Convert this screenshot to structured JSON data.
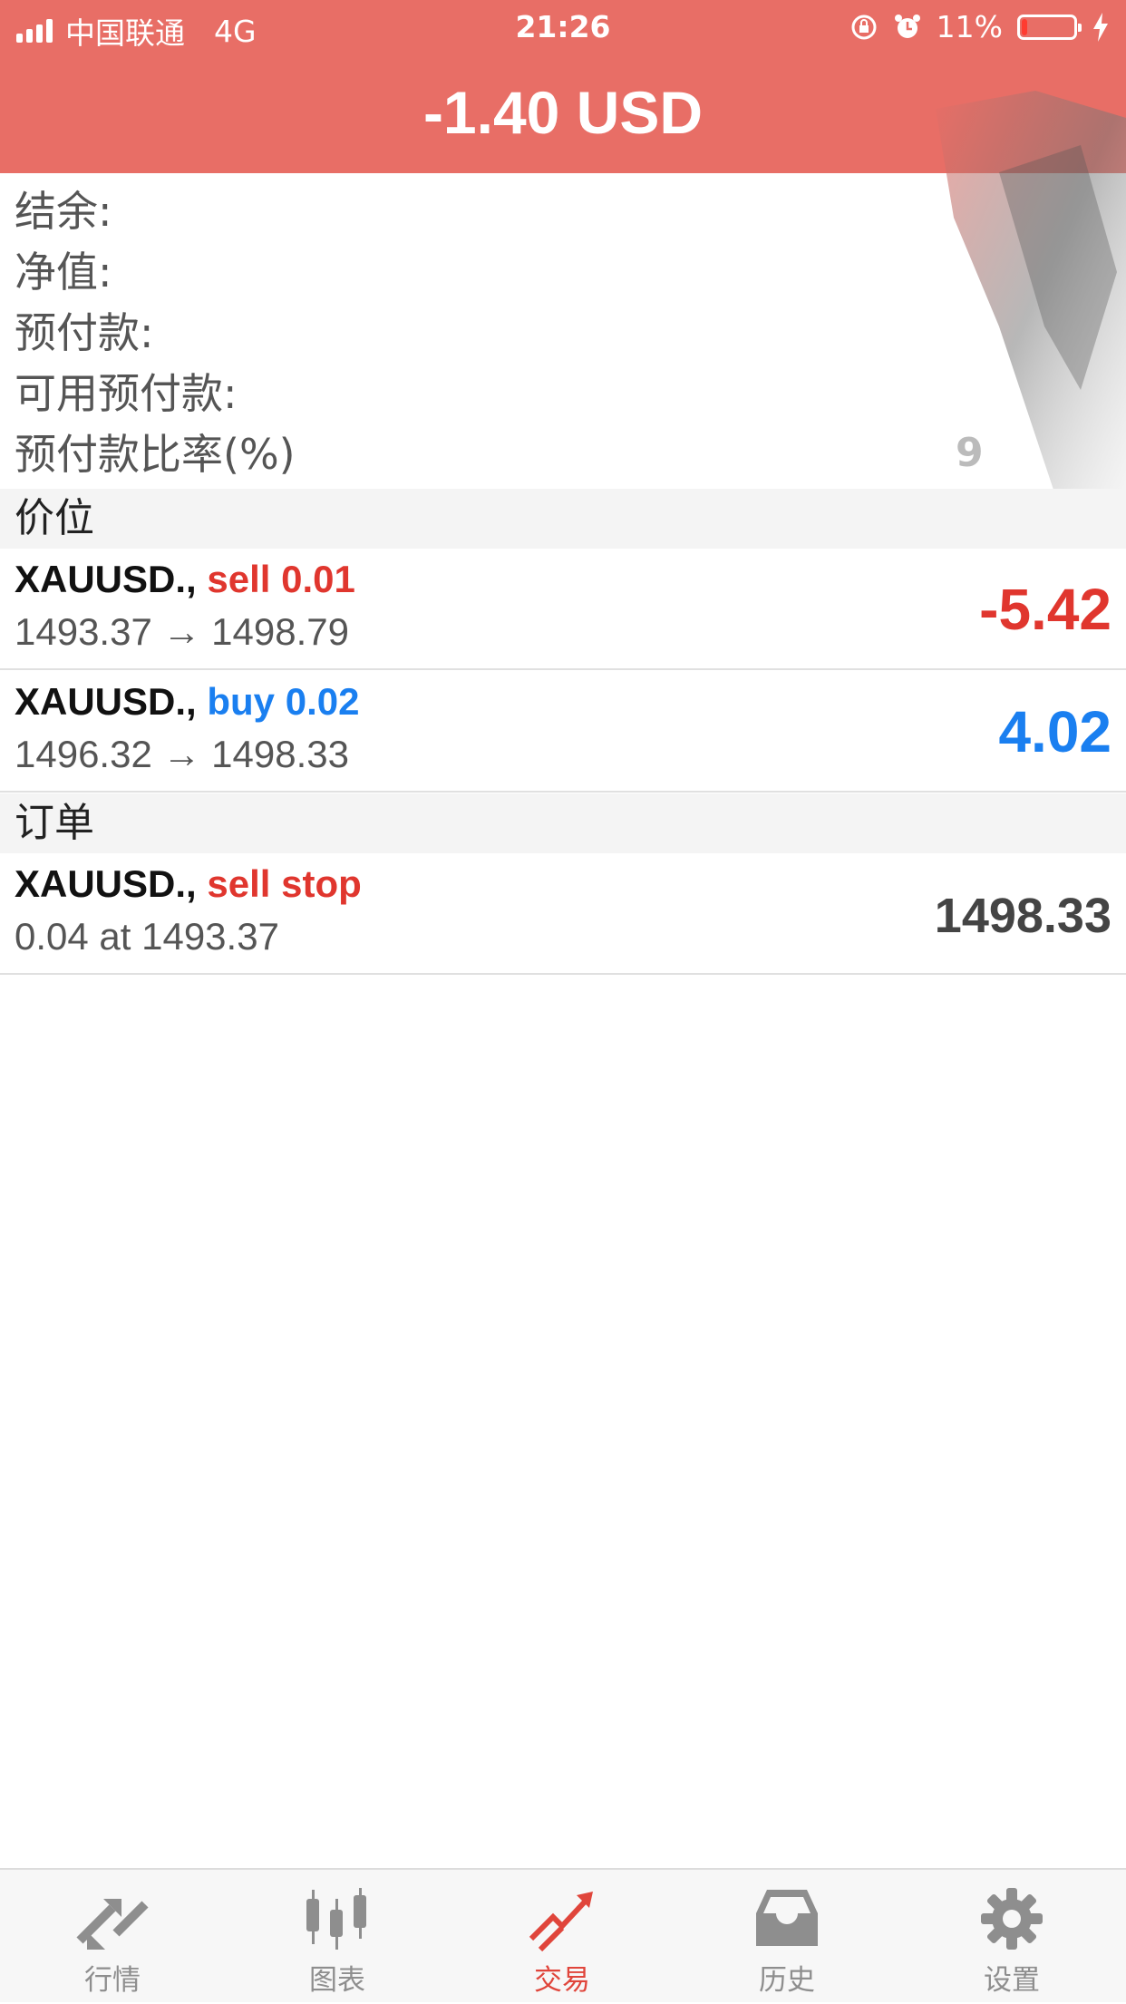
{
  "status_bar": {
    "carrier": "中国联通",
    "network": "4G",
    "time": "21:26",
    "battery": "11%",
    "battery_level": 0.11
  },
  "header": {
    "title": "-1.40 USD",
    "bg_color": "#e86e66"
  },
  "account": {
    "labels": [
      "结余:",
      "净值:",
      "预付款:",
      "可用预付款:",
      "预付款比率(%)"
    ],
    "ratio_partial": "9"
  },
  "sections": {
    "positions": "价位",
    "orders": "订单"
  },
  "positions": [
    {
      "symbol": "XAUUSD.,",
      "side": "sell 0.01",
      "side_type": "sell",
      "prices": "1493.37 → 1498.79",
      "profit": "-5.42"
    },
    {
      "symbol": "XAUUSD.,",
      "side": "buy 0.02",
      "side_type": "buy",
      "prices": "1496.32 → 1498.33",
      "profit": "4.02"
    }
  ],
  "orders": [
    {
      "symbol": "XAUUSD.,",
      "side": "sell stop",
      "side_type": "sell",
      "detail": "0.04 at 1493.37",
      "price": "1498.33"
    }
  ],
  "tabs": [
    {
      "label": "行情",
      "icon": "quotes-icon",
      "active": false
    },
    {
      "label": "图表",
      "icon": "chart-candles-icon",
      "active": false
    },
    {
      "label": "交易",
      "icon": "trade-icon",
      "active": true
    },
    {
      "label": "历史",
      "icon": "history-inbox-icon",
      "active": false
    },
    {
      "label": "设置",
      "icon": "gear-icon",
      "active": false
    }
  ],
  "colors": {
    "sell": "#e0362e",
    "buy": "#1a7ff0",
    "active_tab": "#e0453b",
    "inactive_tab": "#8e8e8e"
  }
}
